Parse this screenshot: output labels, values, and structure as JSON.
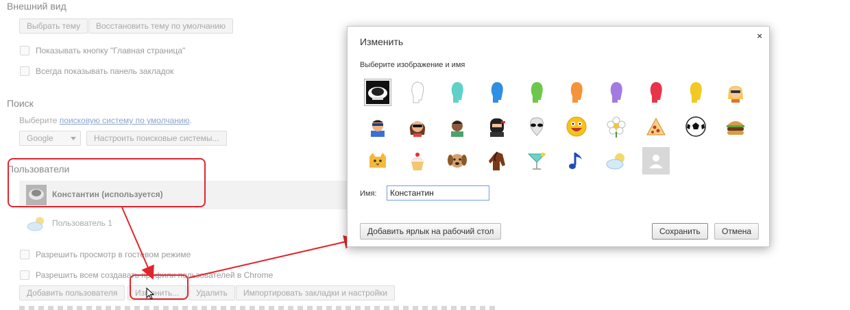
{
  "appearance": {
    "title": "Внешний вид",
    "choose_theme": "Выбрать тему",
    "restore_theme": "Восстановить тему по умолчанию",
    "show_home": "Показывать кнопку \"Главная страница\"",
    "show_bookmarks": "Всегда показывать панель закладок"
  },
  "search": {
    "title": "Поиск",
    "hint_prefix": "Выберите ",
    "hint_link": "поисковую систему по умолчанию",
    "hint_suffix": ".",
    "engine": "Google",
    "configure": "Настроить поисковые системы..."
  },
  "users": {
    "title": "Пользователи",
    "items": [
      {
        "name": "Константин (используется)",
        "active": true
      },
      {
        "name": "Пользователь 1",
        "active": false
      }
    ],
    "allow_guest": "Разрешить просмотр в гостевом режиме",
    "allow_create": "Разрешить всем создавать профили пользователей в Chrome",
    "buttons": {
      "add": "Добавить пользователя",
      "edit": "Изменить...",
      "delete": "Удалить",
      "import": "Импортировать закладки и настройки"
    }
  },
  "dialog": {
    "title": "Изменить",
    "close": "×",
    "subtitle": "Выберите изображение и имя",
    "avatars": [
      "current-photo",
      "white-head",
      "teal-head",
      "blue-head",
      "green-head",
      "orange-head",
      "purple-head",
      "red-head",
      "yellow-head",
      "blonde-woman",
      "superhero",
      "sunglasses-woman",
      "man",
      "ninja",
      "alien",
      "smiley",
      "flower",
      "pizza",
      "soccer-ball",
      "burger",
      "cat",
      "cupcake",
      "dog",
      "horse",
      "cocktail",
      "music-note",
      "sun-cloud",
      "placeholder-person"
    ],
    "name_label": "Имя:",
    "name_value": "Константин",
    "desktop_shortcut": "Добавить ярлык на рабочий стол",
    "save": "Сохранить",
    "cancel": "Отмена"
  },
  "colors": {
    "annotation": "#e3232c",
    "input_focus": "#6e9de4"
  }
}
